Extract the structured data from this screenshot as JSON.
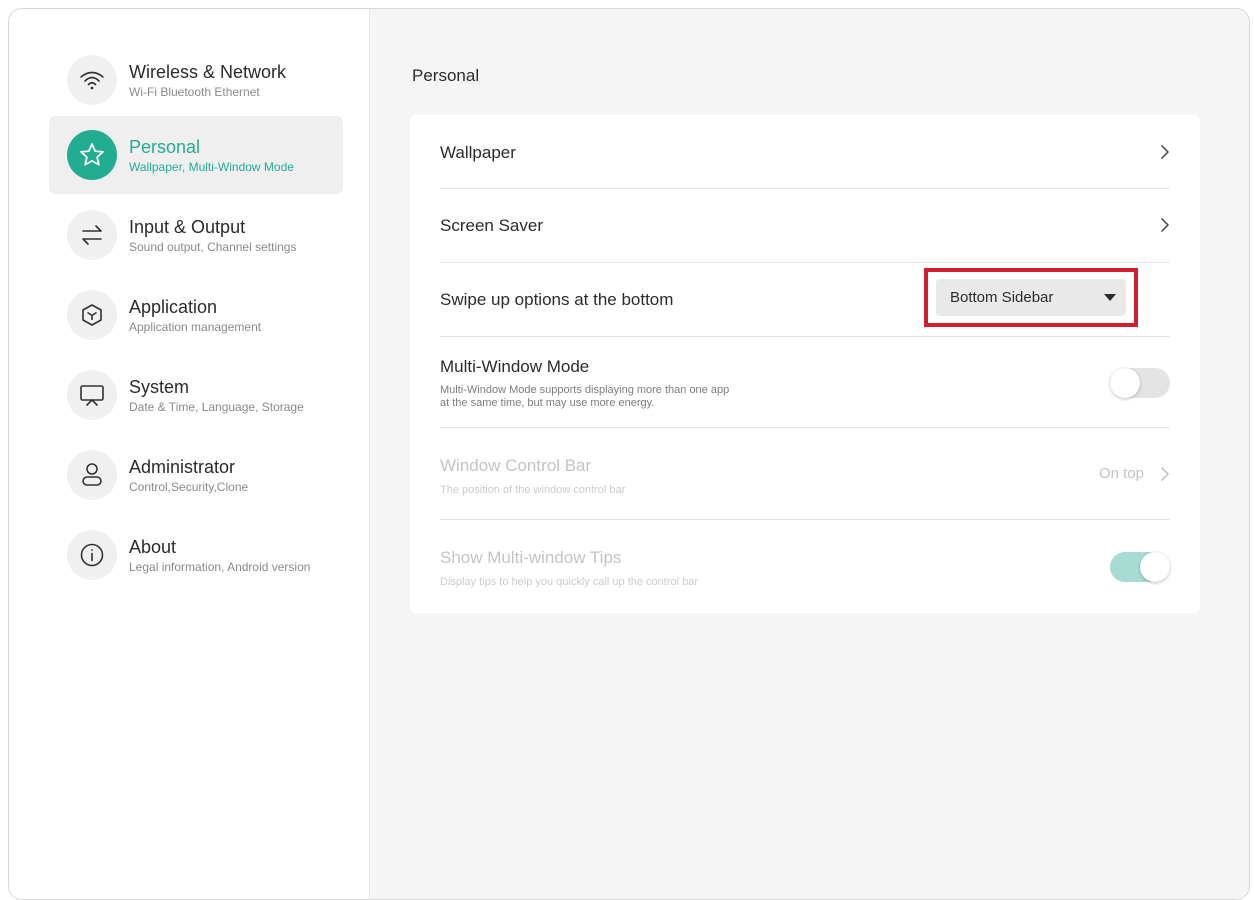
{
  "sidebar": {
    "items": [
      {
        "title": "Wireless & Network",
        "subtitle": "Wi-Fi Bluetooth Ethernet",
        "icon": "wifi-icon"
      },
      {
        "title": "Personal",
        "subtitle": "Wallpaper, Multi-Window Mode",
        "icon": "star-icon",
        "active": true
      },
      {
        "title": "Input & Output",
        "subtitle": "Sound output, Channel settings",
        "icon": "swap-arrows-icon"
      },
      {
        "title": "Application",
        "subtitle": "Application management",
        "icon": "cube-icon"
      },
      {
        "title": "System",
        "subtitle": "Date & Time, Language, Storage",
        "icon": "display-icon"
      },
      {
        "title": "Administrator",
        "subtitle": "Control,Security,Clone",
        "icon": "user-icon"
      },
      {
        "title": "About",
        "subtitle": "Legal information, Android version",
        "icon": "info-icon"
      }
    ]
  },
  "main": {
    "title": "Personal",
    "rows": {
      "wallpaper": {
        "title": "Wallpaper"
      },
      "screen_saver": {
        "title": "Screen Saver"
      },
      "swipe_up": {
        "title": "Swipe up options at the bottom",
        "value": "Bottom Sidebar"
      },
      "multi_window": {
        "title": "Multi-Window Mode",
        "desc_line1": "Multi-Window Mode supports displaying more than one app",
        "desc_line2": "at the same time, but may use more energy.",
        "enabled": false
      },
      "window_control_bar": {
        "title": "Window Control Bar",
        "desc": "The position of the window control bar",
        "value": "On top",
        "disabled": true
      },
      "multi_window_tips": {
        "title": "Show Multi-window Tips",
        "desc": "Display tips to help you quickly call up the control bar",
        "enabled": true,
        "disabled": true
      }
    }
  },
  "colors": {
    "accent": "#22ad92",
    "highlight_box": "#d11f2d",
    "toggle_off": "#e4e4e4",
    "toggle_on_disabled": "#a7dcd2"
  }
}
